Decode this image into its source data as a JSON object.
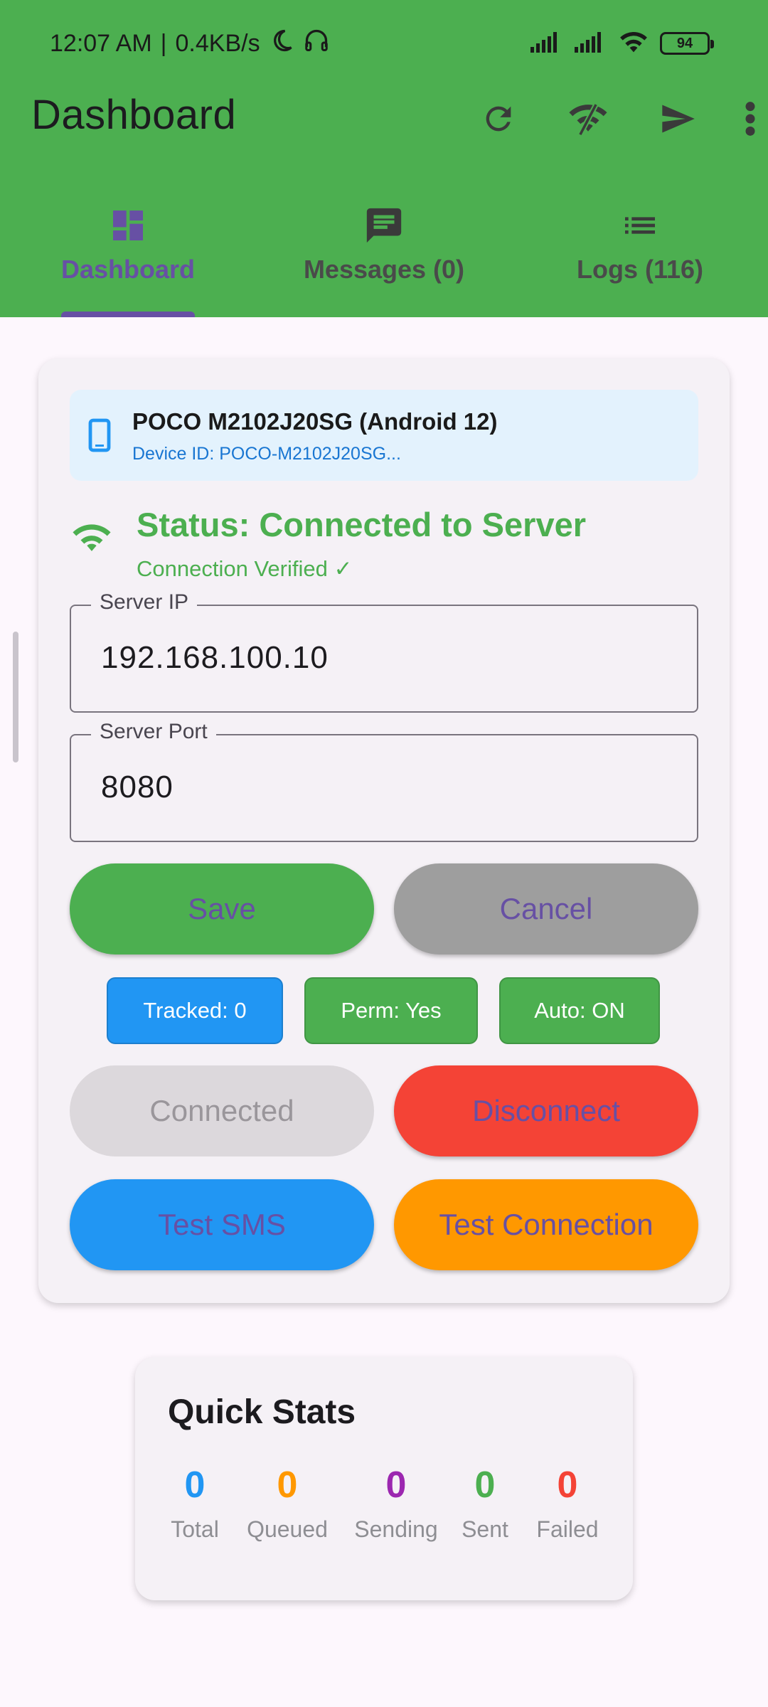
{
  "status_bar": {
    "time": "12:07 AM",
    "separator": "|",
    "speed": "0.4KB/s",
    "battery": "94"
  },
  "appbar": {
    "title": "Dashboard",
    "actions": [
      "refresh-icon",
      "wifi-off-icon",
      "send-icon",
      "more-vert-icon"
    ]
  },
  "tabs": [
    {
      "label": "Dashboard",
      "icon": "dashboard-icon",
      "active": true
    },
    {
      "label": "Messages (0)",
      "icon": "message-icon",
      "active": false
    },
    {
      "label": "Logs (116)",
      "icon": "list-icon",
      "active": false
    }
  ],
  "device": {
    "name": "POCO M2102J20SG (Android 12)",
    "id": "Device ID: POCO-M2102J20SG..."
  },
  "status": {
    "title": "Status: Connected to Server",
    "subtitle": "Connection Verified ✓"
  },
  "fields": {
    "server_ip": {
      "label": "Server IP",
      "value": "192.168.100.10"
    },
    "server_port": {
      "label": "Server Port",
      "value": "8080"
    }
  },
  "buttons": {
    "save": "Save",
    "cancel": "Cancel",
    "connected": "Connected",
    "disconnect": "Disconnect",
    "test_sms": "Test SMS",
    "test_connection": "Test Connection"
  },
  "chips": {
    "tracked": "Tracked: 0",
    "perm": "Perm: Yes",
    "auto": "Auto: ON"
  },
  "quick_stats": {
    "title": "Quick Stats",
    "items": [
      {
        "value": "0",
        "label": "Total",
        "color": "#2196f3"
      },
      {
        "value": "0",
        "label": "Queued",
        "color": "#ff9800"
      },
      {
        "value": "0",
        "label": "Sending",
        "color": "#9c27b0"
      },
      {
        "value": "0",
        "label": "Sent",
        "color": "#4caf50"
      },
      {
        "value": "0",
        "label": "Failed",
        "color": "#f44336"
      }
    ]
  },
  "colors": {
    "primary_green": "#4caf50",
    "accent_purple": "#6750a4",
    "blue": "#2196f3",
    "orange": "#ff9800",
    "red": "#f44336",
    "grey": "#9e9e9e"
  }
}
